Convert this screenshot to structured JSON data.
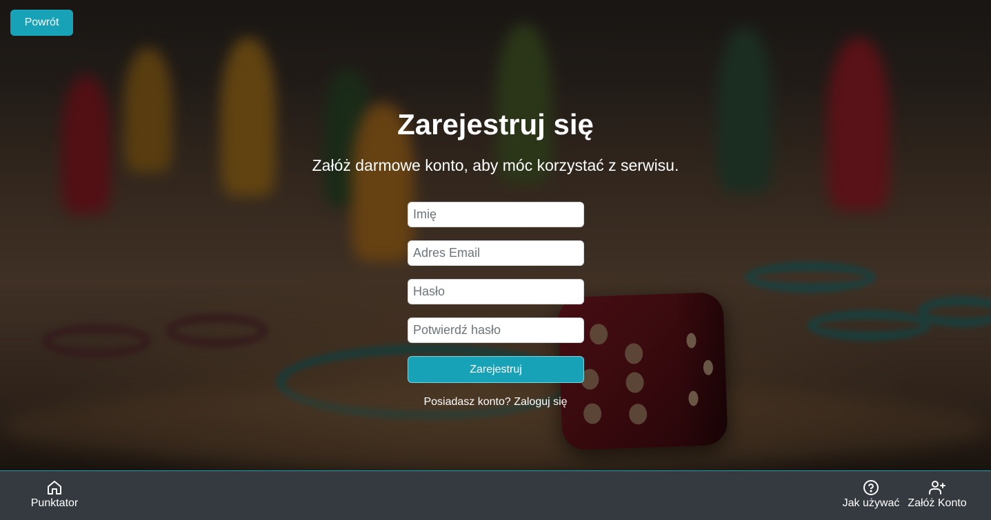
{
  "header": {
    "back_label": "Powrót"
  },
  "main": {
    "title": "Zarejestruj się",
    "subtitle": "Załóż darmowe konto, aby móc korzystać z serwisu.",
    "form": {
      "name_placeholder": "Imię",
      "email_placeholder": "Adres Email",
      "password_placeholder": "Hasło",
      "confirm_placeholder": "Potwierdź hasło",
      "submit_label": "Zarejestruj"
    },
    "login_prompt": "Posiadasz konto? Zaloguj się"
  },
  "footer": {
    "items": [
      {
        "label": "Punktator",
        "icon": "home-icon"
      },
      {
        "label": "Jak używać",
        "icon": "help-icon"
      },
      {
        "label": "Załóż Konto",
        "icon": "user-plus-icon"
      }
    ]
  },
  "colors": {
    "accent": "#17a2b8",
    "footer_bg": "#343a40"
  }
}
